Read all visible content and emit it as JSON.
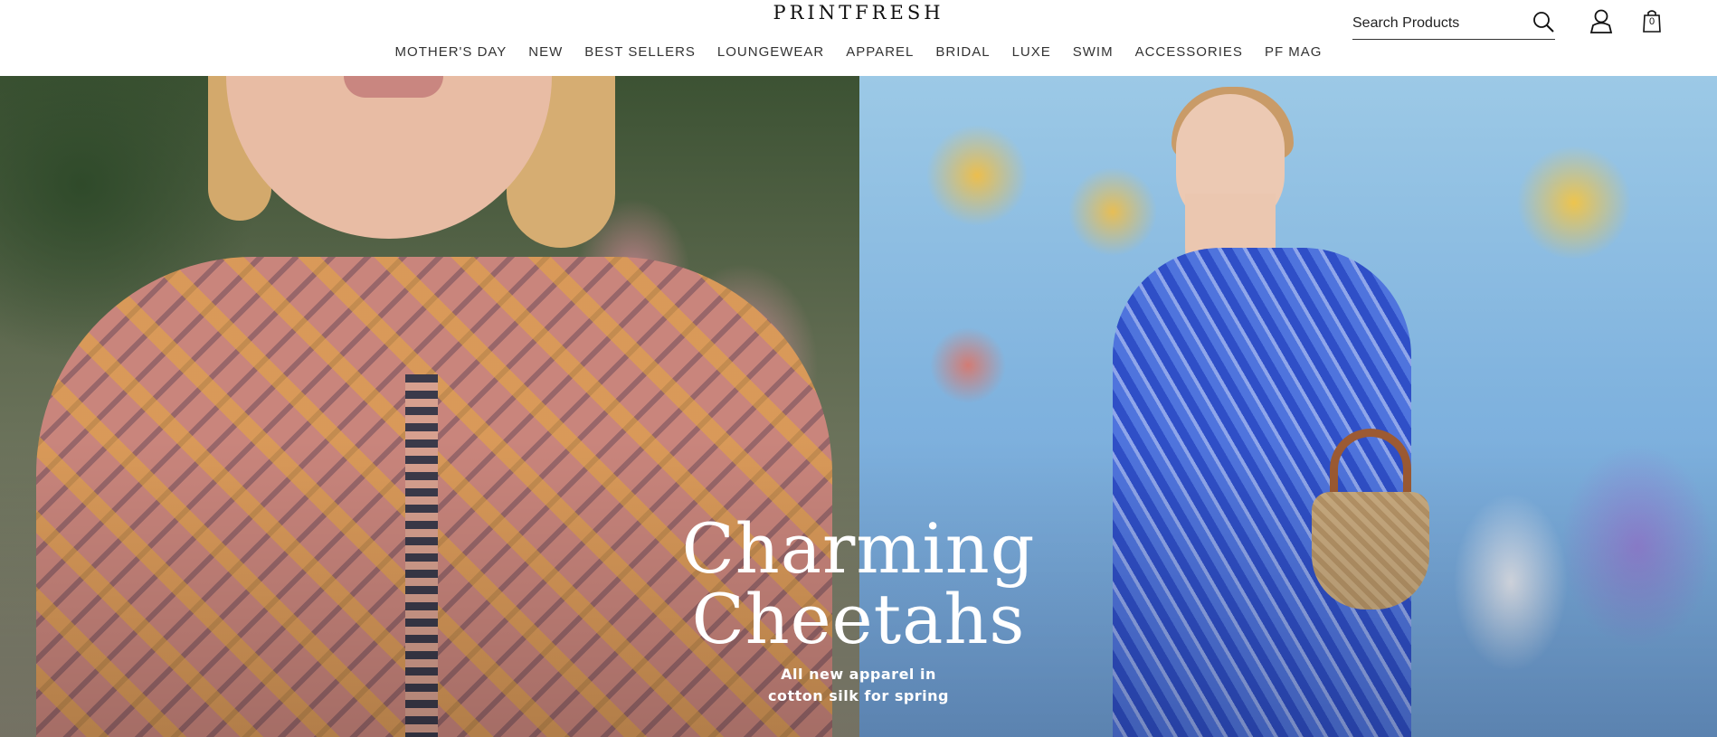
{
  "header": {
    "logo": "PRINTFRESH",
    "nav": [
      "MOTHER'S DAY",
      "NEW",
      "BEST SELLERS",
      "LOUNGEWEAR",
      "APPAREL",
      "BRIDAL",
      "LUXE",
      "SWIM",
      "ACCESSORIES",
      "PF MAG"
    ],
    "search": {
      "placeholder": "Search Products",
      "icon": "search-icon"
    },
    "account_icon": "user-icon",
    "bag": {
      "icon": "shopping-bag-icon",
      "count": "0"
    }
  },
  "hero": {
    "headline_line1": "Charming",
    "headline_line2": "Cheetahs",
    "subline_line1": "All new apparel in",
    "subline_line2": "cotton silk for spring"
  },
  "colors": {
    "header_bg": "#ffffff",
    "text": "#111111",
    "hero_text": "#ffffff"
  }
}
